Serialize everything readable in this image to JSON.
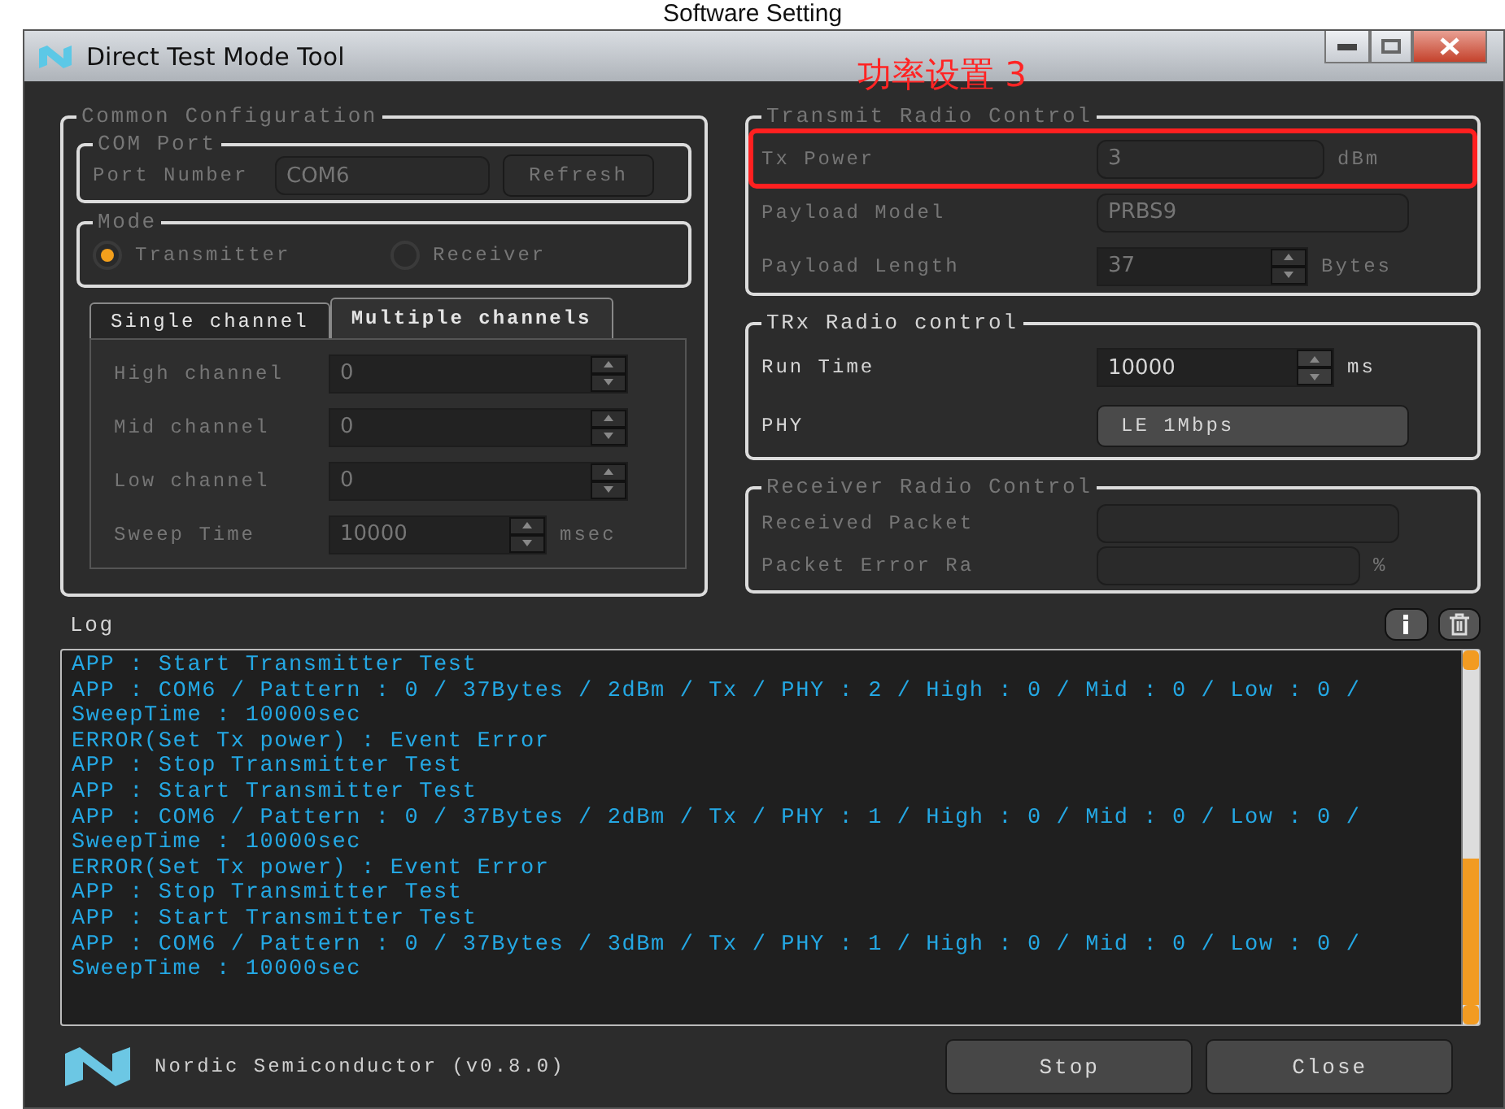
{
  "caption": "Software Setting",
  "window": {
    "title": "Direct Test Mode Tool"
  },
  "annotation": {
    "text": "功率设置 3"
  },
  "common_configuration": {
    "title": "Common Configuration",
    "disabled": true,
    "com_port": {
      "title": "COM Port",
      "label": "Port Number",
      "value": "COM6",
      "button": "Refresh"
    },
    "mode": {
      "title": "Mode",
      "options": [
        {
          "label": "Transmitter",
          "selected": true
        },
        {
          "label": "Receiver",
          "selected": false
        }
      ]
    },
    "tabs": [
      {
        "label": "Single channel",
        "selected": false
      },
      {
        "label": "Multiple channels",
        "selected": true
      }
    ],
    "channel_fields": [
      {
        "label": "High channel",
        "value": "0",
        "kind": "spin"
      },
      {
        "label": "Mid channel",
        "value": "0",
        "kind": "spin"
      },
      {
        "label": "Low channel",
        "value": "0",
        "kind": "spin"
      },
      {
        "label": "Sweep Time",
        "value": "10000",
        "unit": "msec",
        "kind": "short-spin"
      }
    ]
  },
  "transmit_radio_control": {
    "title": "Transmit Radio Control",
    "disabled": true,
    "fields": [
      {
        "label": "Tx Power",
        "value": "3",
        "unit": "dBm",
        "kind": "text",
        "highlighted": true
      },
      {
        "label": "Payload Model",
        "value": "PRBS9",
        "kind": "combo",
        "highlighted": false
      },
      {
        "label": "Payload Length",
        "value": "37",
        "unit": "Bytes",
        "kind": "spin",
        "highlighted": false
      }
    ]
  },
  "trx_radio_control": {
    "title": "TRx Radio control",
    "disabled": false,
    "fields": [
      {
        "label": "Run Time",
        "value": "10000",
        "unit": "ms",
        "kind": "spin",
        "highlighted": false
      },
      {
        "label": "PHY",
        "value": "LE 1Mbps",
        "kind": "button",
        "highlighted": false
      }
    ]
  },
  "receiver_radio_control": {
    "title": "Receiver Radio Control",
    "disabled": true,
    "fields": [
      {
        "label": "Received Packet",
        "kind": "text",
        "highlighted": false
      },
      {
        "label": "Packet Error Ra",
        "unit": "%",
        "kind": "text",
        "highlighted": false
      }
    ]
  },
  "log": {
    "title": "Log",
    "lines": [
      "APP : Start Transmitter Test",
      "APP : COM6 / Pattern : 0 / 37Bytes / 2dBm / Tx / PHY : 2 / High : 0 / Mid : 0 / Low : 0 /",
      "SweepTime : 10000sec",
      "ERROR(Set Tx power) : Event Error",
      "APP : Stop Transmitter Test",
      "APP : Start Transmitter Test",
      "APP : COM6 / Pattern : 0 / 37Bytes / 2dBm / Tx / PHY : 1 / High : 0 / Mid : 0 / Low : 0 /",
      "SweepTime : 10000sec",
      "ERROR(Set Tx power) : Event Error",
      "APP : Stop Transmitter Test",
      "APP : Start Transmitter Test",
      "APP : COM6 / Pattern : 0 / 37Bytes / 3dBm / Tx / PHY : 1 / High : 0 / Mid : 0 / Low : 0 /",
      "SweepTime : 10000sec"
    ]
  },
  "footer": {
    "company": "Nordic Semiconductor (v0.8.0)",
    "buttons": [
      "Stop",
      "Close"
    ]
  }
}
